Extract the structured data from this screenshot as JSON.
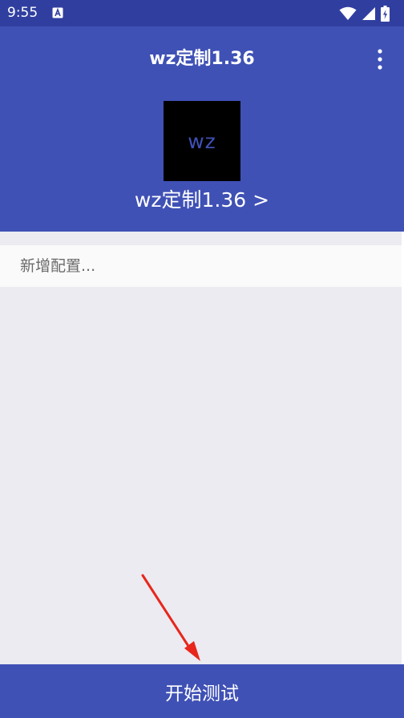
{
  "status_bar": {
    "time": "9:55",
    "notification_icon": "a-badge-icon",
    "icons": [
      "wifi-icon",
      "signal-icon",
      "battery-charging-icon"
    ]
  },
  "app_bar": {
    "title": "wz定制1.36",
    "menu_icon": "more-vert-icon"
  },
  "profile": {
    "logo_text": "wz",
    "link_text": "wz定制1.36 >"
  },
  "config_list": {
    "add_item_label": "新增配置..."
  },
  "bottom_button": {
    "label": "开始测试"
  },
  "colors": {
    "status_bar": "#303f9f",
    "primary": "#3f51b5",
    "background": "#ebebf1",
    "logo_bg": "#000000",
    "annotation_arrow": "#e8261c"
  }
}
